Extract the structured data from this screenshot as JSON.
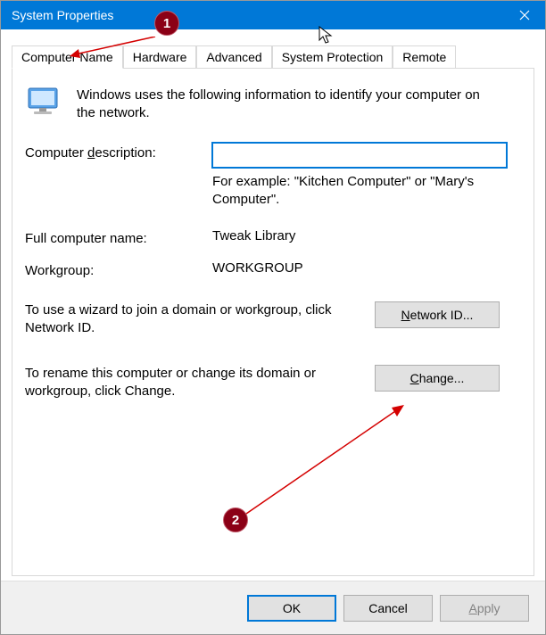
{
  "titlebar": {
    "title": "System Properties"
  },
  "tabs": {
    "items": [
      {
        "label": "Computer Name"
      },
      {
        "label": "Hardware"
      },
      {
        "label": "Advanced"
      },
      {
        "label": "System Protection"
      },
      {
        "label": "Remote"
      }
    ]
  },
  "intro": {
    "text": "Windows uses the following information to identify your computer on the network."
  },
  "description": {
    "label": "Computer description:",
    "value": "",
    "example": "For example: \"Kitchen Computer\" or \"Mary's Computer\"."
  },
  "fullname": {
    "label": "Full computer name:",
    "value": "Tweak Library"
  },
  "workgroup": {
    "label": "Workgroup:",
    "value": "WORKGROUP"
  },
  "wizard": {
    "text": "To use a wizard to join a domain or workgroup, click Network ID.",
    "button_pre": "N",
    "button_post": "etwork ID..."
  },
  "rename": {
    "text": "To rename this computer or change its domain or workgroup, click Change.",
    "button_pre": "C",
    "button_post": "hange..."
  },
  "footer": {
    "ok": "OK",
    "cancel": "Cancel",
    "apply_pre": "A",
    "apply_post": "pply"
  },
  "annotations": {
    "badge1": "1",
    "badge2": "2"
  }
}
